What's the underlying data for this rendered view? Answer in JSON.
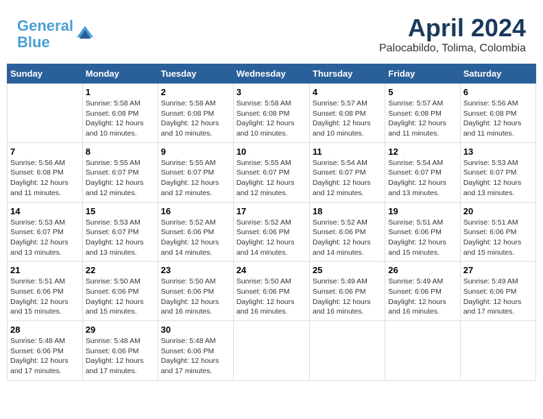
{
  "header": {
    "logo_line1": "General",
    "logo_line2": "Blue",
    "month_title": "April 2024",
    "subtitle": "Palocabildo, Tolima, Colombia"
  },
  "weekdays": [
    "Sunday",
    "Monday",
    "Tuesday",
    "Wednesday",
    "Thursday",
    "Friday",
    "Saturday"
  ],
  "weeks": [
    [
      {
        "day": "",
        "sunrise": "",
        "sunset": "",
        "daylight": ""
      },
      {
        "day": "1",
        "sunrise": "Sunrise: 5:58 AM",
        "sunset": "Sunset: 6:08 PM",
        "daylight": "Daylight: 12 hours and 10 minutes."
      },
      {
        "day": "2",
        "sunrise": "Sunrise: 5:58 AM",
        "sunset": "Sunset: 6:08 PM",
        "daylight": "Daylight: 12 hours and 10 minutes."
      },
      {
        "day": "3",
        "sunrise": "Sunrise: 5:58 AM",
        "sunset": "Sunset: 6:08 PM",
        "daylight": "Daylight: 12 hours and 10 minutes."
      },
      {
        "day": "4",
        "sunrise": "Sunrise: 5:57 AM",
        "sunset": "Sunset: 6:08 PM",
        "daylight": "Daylight: 12 hours and 10 minutes."
      },
      {
        "day": "5",
        "sunrise": "Sunrise: 5:57 AM",
        "sunset": "Sunset: 6:08 PM",
        "daylight": "Daylight: 12 hours and 11 minutes."
      },
      {
        "day": "6",
        "sunrise": "Sunrise: 5:56 AM",
        "sunset": "Sunset: 6:08 PM",
        "daylight": "Daylight: 12 hours and 11 minutes."
      }
    ],
    [
      {
        "day": "7",
        "sunrise": "Sunrise: 5:56 AM",
        "sunset": "Sunset: 6:08 PM",
        "daylight": "Daylight: 12 hours and 11 minutes."
      },
      {
        "day": "8",
        "sunrise": "Sunrise: 5:55 AM",
        "sunset": "Sunset: 6:07 PM",
        "daylight": "Daylight: 12 hours and 12 minutes."
      },
      {
        "day": "9",
        "sunrise": "Sunrise: 5:55 AM",
        "sunset": "Sunset: 6:07 PM",
        "daylight": "Daylight: 12 hours and 12 minutes."
      },
      {
        "day": "10",
        "sunrise": "Sunrise: 5:55 AM",
        "sunset": "Sunset: 6:07 PM",
        "daylight": "Daylight: 12 hours and 12 minutes."
      },
      {
        "day": "11",
        "sunrise": "Sunrise: 5:54 AM",
        "sunset": "Sunset: 6:07 PM",
        "daylight": "Daylight: 12 hours and 12 minutes."
      },
      {
        "day": "12",
        "sunrise": "Sunrise: 5:54 AM",
        "sunset": "Sunset: 6:07 PM",
        "daylight": "Daylight: 12 hours and 13 minutes."
      },
      {
        "day": "13",
        "sunrise": "Sunrise: 5:53 AM",
        "sunset": "Sunset: 6:07 PM",
        "daylight": "Daylight: 12 hours and 13 minutes."
      }
    ],
    [
      {
        "day": "14",
        "sunrise": "Sunrise: 5:53 AM",
        "sunset": "Sunset: 6:07 PM",
        "daylight": "Daylight: 12 hours and 13 minutes."
      },
      {
        "day": "15",
        "sunrise": "Sunrise: 5:53 AM",
        "sunset": "Sunset: 6:07 PM",
        "daylight": "Daylight: 12 hours and 13 minutes."
      },
      {
        "day": "16",
        "sunrise": "Sunrise: 5:52 AM",
        "sunset": "Sunset: 6:06 PM",
        "daylight": "Daylight: 12 hours and 14 minutes."
      },
      {
        "day": "17",
        "sunrise": "Sunrise: 5:52 AM",
        "sunset": "Sunset: 6:06 PM",
        "daylight": "Daylight: 12 hours and 14 minutes."
      },
      {
        "day": "18",
        "sunrise": "Sunrise: 5:52 AM",
        "sunset": "Sunset: 6:06 PM",
        "daylight": "Daylight: 12 hours and 14 minutes."
      },
      {
        "day": "19",
        "sunrise": "Sunrise: 5:51 AM",
        "sunset": "Sunset: 6:06 PM",
        "daylight": "Daylight: 12 hours and 15 minutes."
      },
      {
        "day": "20",
        "sunrise": "Sunrise: 5:51 AM",
        "sunset": "Sunset: 6:06 PM",
        "daylight": "Daylight: 12 hours and 15 minutes."
      }
    ],
    [
      {
        "day": "21",
        "sunrise": "Sunrise: 5:51 AM",
        "sunset": "Sunset: 6:06 PM",
        "daylight": "Daylight: 12 hours and 15 minutes."
      },
      {
        "day": "22",
        "sunrise": "Sunrise: 5:50 AM",
        "sunset": "Sunset: 6:06 PM",
        "daylight": "Daylight: 12 hours and 15 minutes."
      },
      {
        "day": "23",
        "sunrise": "Sunrise: 5:50 AM",
        "sunset": "Sunset: 6:06 PM",
        "daylight": "Daylight: 12 hours and 16 minutes."
      },
      {
        "day": "24",
        "sunrise": "Sunrise: 5:50 AM",
        "sunset": "Sunset: 6:06 PM",
        "daylight": "Daylight: 12 hours and 16 minutes."
      },
      {
        "day": "25",
        "sunrise": "Sunrise: 5:49 AM",
        "sunset": "Sunset: 6:06 PM",
        "daylight": "Daylight: 12 hours and 16 minutes."
      },
      {
        "day": "26",
        "sunrise": "Sunrise: 5:49 AM",
        "sunset": "Sunset: 6:06 PM",
        "daylight": "Daylight: 12 hours and 16 minutes."
      },
      {
        "day": "27",
        "sunrise": "Sunrise: 5:49 AM",
        "sunset": "Sunset: 6:06 PM",
        "daylight": "Daylight: 12 hours and 17 minutes."
      }
    ],
    [
      {
        "day": "28",
        "sunrise": "Sunrise: 5:48 AM",
        "sunset": "Sunset: 6:06 PM",
        "daylight": "Daylight: 12 hours and 17 minutes."
      },
      {
        "day": "29",
        "sunrise": "Sunrise: 5:48 AM",
        "sunset": "Sunset: 6:06 PM",
        "daylight": "Daylight: 12 hours and 17 minutes."
      },
      {
        "day": "30",
        "sunrise": "Sunrise: 5:48 AM",
        "sunset": "Sunset: 6:06 PM",
        "daylight": "Daylight: 12 hours and 17 minutes."
      },
      {
        "day": "",
        "sunrise": "",
        "sunset": "",
        "daylight": ""
      },
      {
        "day": "",
        "sunrise": "",
        "sunset": "",
        "daylight": ""
      },
      {
        "day": "",
        "sunrise": "",
        "sunset": "",
        "daylight": ""
      },
      {
        "day": "",
        "sunrise": "",
        "sunset": "",
        "daylight": ""
      }
    ]
  ]
}
